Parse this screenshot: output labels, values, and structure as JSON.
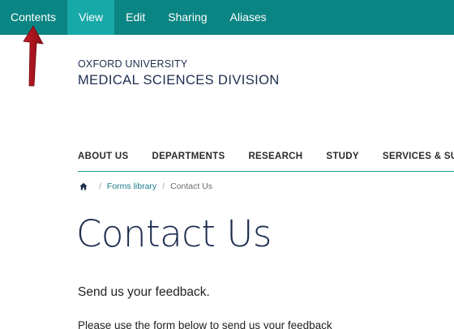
{
  "toolbar": {
    "items": [
      {
        "label": "Contents"
      },
      {
        "label": "View",
        "active": true
      },
      {
        "label": "Edit"
      },
      {
        "label": "Sharing"
      },
      {
        "label": "Aliases"
      }
    ],
    "background": "#0b8583",
    "active_background": "#17a9a8"
  },
  "logo": {
    "line1": "OXFORD UNIVERSITY",
    "line2": "MEDICAL SCIENCES DIVISION"
  },
  "mainnav": {
    "items": [
      {
        "label": "ABOUT US"
      },
      {
        "label": "DEPARTMENTS"
      },
      {
        "label": "RESEARCH"
      },
      {
        "label": "STUDY"
      },
      {
        "label": "SERVICES & SUPPOR"
      }
    ],
    "underline_color": "#1a9c99"
  },
  "breadcrumb": {
    "home_icon": "home-icon",
    "separator": "/",
    "link": "Forms library",
    "current": "Contact Us"
  },
  "main": {
    "title": "Contact Us",
    "lead": "Send us your feedback.",
    "paragraph": "Please use the form below to send us your feedback"
  },
  "annotation": {
    "icon": "red-arrow-icon",
    "color": "#a3141e"
  }
}
